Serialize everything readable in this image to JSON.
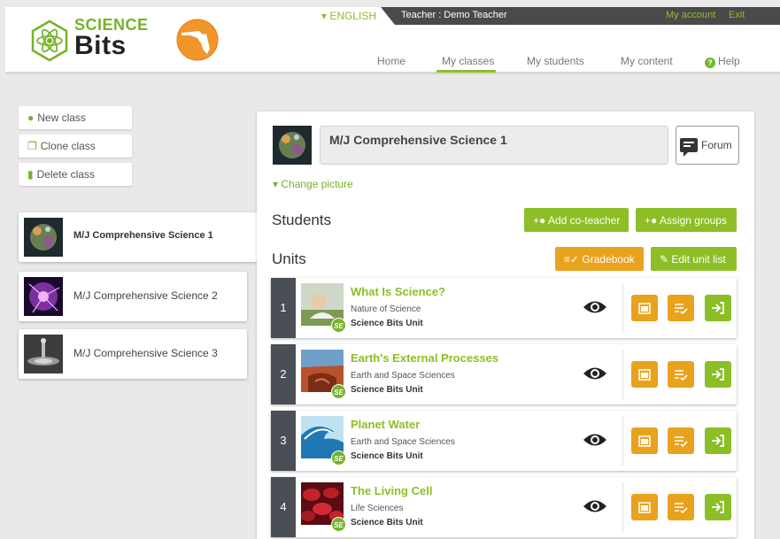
{
  "topbar": {
    "language": "▾ ENGLISH",
    "teacher": "Teacher : Demo Teacher",
    "my_account": "My account",
    "exit": "Exit"
  },
  "logo": {
    "science": "SCIENCE",
    "bits": "Bits"
  },
  "nav": {
    "home": "Home",
    "my_classes": "My classes",
    "my_students": "My students",
    "my_content": "My content",
    "help": "Help"
  },
  "sidebar": {
    "new_class": "New class",
    "clone_class": "Clone class",
    "delete_class": "Delete class",
    "classes": [
      {
        "name": "M/J Comprehensive Science 1"
      },
      {
        "name": "M/J Comprehensive Science 2"
      },
      {
        "name": "M/J Comprehensive Science 3"
      }
    ]
  },
  "main": {
    "class_title": "M/J Comprehensive Science 1",
    "forum": "Forum",
    "change_picture": "▾ Change picture",
    "students_heading": "Students",
    "add_coteacher": "Add co-teacher",
    "assign_groups": "Assign groups",
    "units_heading": "Units",
    "gradebook": "Gradebook",
    "edit_unit_list": "Edit unit list",
    "units": [
      {
        "num": "1",
        "title": "What Is Science?",
        "subject": "Nature of Science",
        "type": "Science Bits Unit",
        "badge": "SE"
      },
      {
        "num": "2",
        "title": "Earth's External Processes",
        "subject": "Earth and Space Sciences",
        "type": "Science Bits Unit",
        "badge": "SE"
      },
      {
        "num": "3",
        "title": "Planet Water",
        "subject": "Earth and Space Sciences",
        "type": "Science Bits Unit",
        "badge": "SE"
      },
      {
        "num": "4",
        "title": "The Living Cell",
        "subject": "Life Sciences",
        "type": "Science Bits Unit",
        "badge": "SE"
      }
    ]
  },
  "colors": {
    "brand_green": "#8cbf26",
    "accent_orange": "#e9a21d",
    "topbar": "#4a4a4a"
  }
}
